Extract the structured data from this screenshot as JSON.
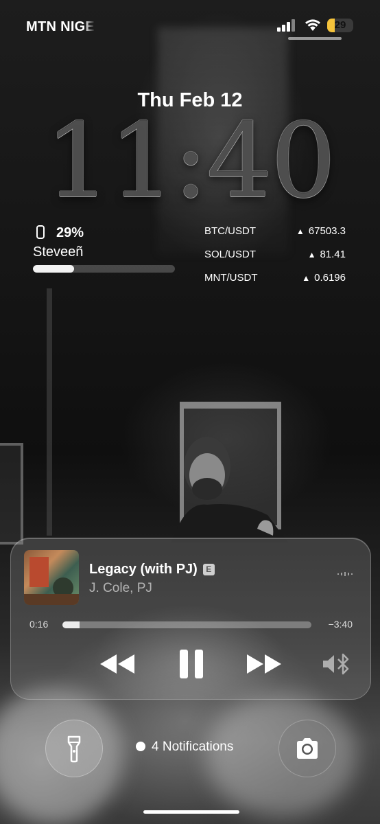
{
  "status_bar": {
    "carrier": "MTN NIGE",
    "battery_level": "29",
    "battery_fraction": 0.29,
    "icons": [
      "signal-icon",
      "wifi-icon",
      "battery-icon"
    ]
  },
  "lock_screen": {
    "date": "Thu Feb 12",
    "time": "11:40"
  },
  "widgets": {
    "device_battery": {
      "icon": "phone-icon",
      "percent": "29%",
      "device_name": "Steveeñ",
      "level": 0.29
    },
    "crypto": [
      {
        "pair": "BTC/USDT",
        "value": "67503.3"
      },
      {
        "pair": "SOL/USDT",
        "value": "81.41"
      },
      {
        "pair": "MNT/USDT",
        "value": "0.6196"
      }
    ]
  },
  "now_playing": {
    "title": "Legacy (with PJ)",
    "explicit_badge": "E",
    "artist": "J. Cole, PJ",
    "elapsed": "0:16",
    "remaining": "−3:40",
    "progress_fraction": 0.07,
    "controls": [
      "rewind-icon",
      "pause-icon",
      "fast-forward-icon",
      "bluetooth-speaker-icon"
    ]
  },
  "bottom": {
    "notifications": "4 Notifications",
    "left_button_icon": "flashlight-icon",
    "right_button_icon": "camera-icon"
  },
  "colors": {
    "battery_accent": "#f5c33b",
    "text": "#ffffff"
  }
}
